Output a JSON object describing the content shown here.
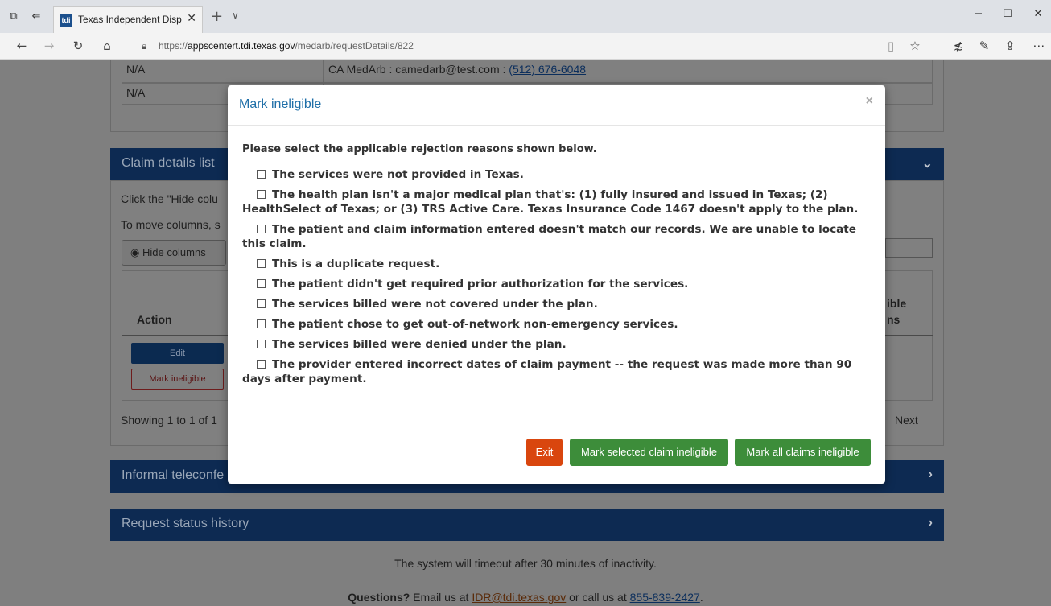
{
  "browser": {
    "tab_title": "Texas Independent Disp",
    "tab_favicon_text": "tdi",
    "url_prefix": "https://",
    "url_host": "appscentert.tdi.texas.gov",
    "url_path": "/medarb/requestDetails/822"
  },
  "background": {
    "contact_rows": [
      {
        "left": "N/A",
        "right_text": "CA MedArb : camedarb@test.com : ",
        "right_phone": "(512) 676-6048"
      },
      {
        "left": "N/A",
        "right_text": "",
        "right_phone": ""
      }
    ],
    "claim_panel_title": "Claim details list",
    "claim_instructions_1": "Click the \"Hide colu",
    "claim_instructions_2": "To move columns, s",
    "hide_columns_label": "Hide columns",
    "table_header_action": "Action",
    "table_header_right_1": "ible",
    "table_header_right_2": "ns",
    "edit_label": "Edit",
    "mark_ineligible_label": "Mark ineligible",
    "showing_text": "Showing 1 to 1 of 1",
    "next_label": "Next",
    "teleconf_title": "Informal teleconfe",
    "status_history_title": "Request status history",
    "timeout_text": "The system will timeout after 30 minutes of inactivity.",
    "questions_bold": "Questions?",
    "questions_text_1": " Email us at ",
    "questions_email": "IDR@tdi.texas.gov",
    "questions_text_2": " or call us at ",
    "questions_phone": "855-839-2427",
    "questions_text_3": "."
  },
  "modal": {
    "title": "Mark ineligible",
    "close_glyph": "×",
    "intro": "Please select the applicable rejection reasons shown below.",
    "reasons": [
      "The services were not provided in Texas.",
      "The health plan isn't a major medical plan that's: (1) fully insured and issued in Texas; (2) HealthSelect of Texas; or (3) TRS Active Care. Texas Insurance Code 1467 doesn't apply to the plan.",
      "The patient and claim information entered doesn't match our records. We are unable to locate this claim.",
      "This is a duplicate request.",
      "The patient didn't get required prior authorization for the services.",
      "The services billed were not covered under the plan.",
      "The patient chose to get out-of-network non-emergency services.",
      "The services billed were denied under the plan.",
      "The provider entered incorrect dates of claim payment -- the request was made more than 90 days after payment."
    ],
    "exit_label": "Exit",
    "mark_selected_label": "Mark selected claim ineligible",
    "mark_all_label": "Mark all claims ineligible"
  },
  "colors": {
    "modal_title": "#1f6fa8",
    "exit_button": "#d9460e",
    "confirm_button": "#3d8d3a",
    "panel_header": "#0d2a52"
  }
}
